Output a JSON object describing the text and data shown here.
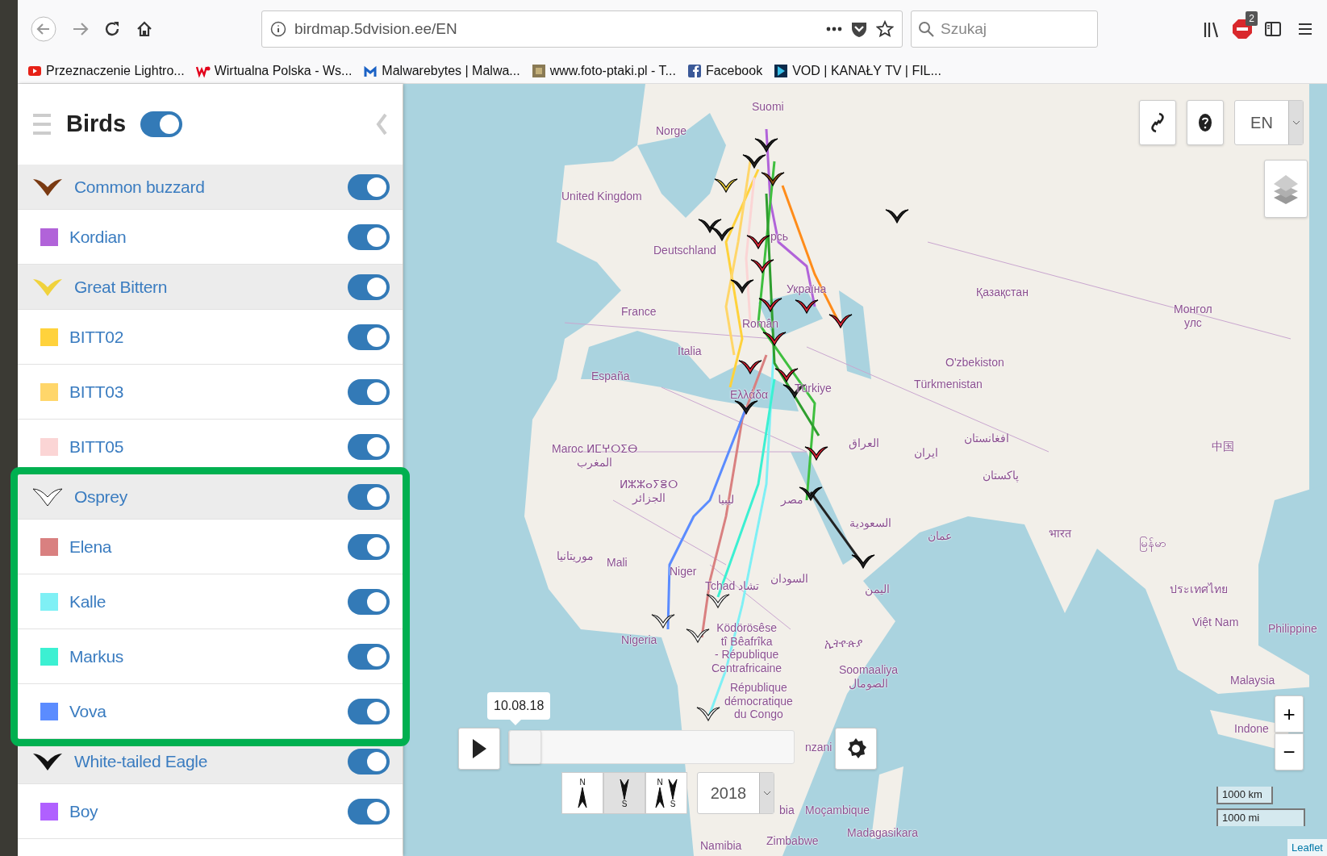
{
  "browser": {
    "url": "birdmap.5dvision.ee/EN",
    "search": {
      "placeholder": "Szukaj"
    },
    "adblock_badge": "2",
    "bookmarks": [
      {
        "kind": "video",
        "label": "Przeznaczenie Lightro..."
      },
      {
        "kind": "portal",
        "label": "Wirtualna Polska - Ws..."
      },
      {
        "kind": "shield",
        "label": "Malwarebytes | Malwa..."
      },
      {
        "kind": "photo",
        "label": "www.foto-ptaki.pl - T..."
      },
      {
        "kind": "social",
        "label": "Facebook"
      },
      {
        "kind": "play",
        "label": "VOD | KANAŁY TV | FIL..."
      }
    ]
  },
  "sidebar": {
    "title": "Birds",
    "on": true,
    "groups": [
      {
        "name": "Common buzzard",
        "color": "#7a3a12",
        "on": true,
        "highlighted": false,
        "birds": [
          {
            "name": "Kordian",
            "color": "#b163d9",
            "on": true
          }
        ]
      },
      {
        "name": "Great Bittern",
        "color": "#f0d23c",
        "on": true,
        "highlighted": false,
        "birds": [
          {
            "name": "BITT02",
            "color": "#ffd23c",
            "on": true
          },
          {
            "name": "BITT03",
            "color": "#ffd66a",
            "on": true
          },
          {
            "name": "BITT05",
            "color": "#fbd5d5",
            "on": true
          }
        ]
      },
      {
        "name": "Osprey",
        "color": "#ffffff",
        "on": true,
        "highlighted": true,
        "birds": [
          {
            "name": "Elena",
            "color": "#d98080",
            "on": true
          },
          {
            "name": "Kalle",
            "color": "#7ff0f5",
            "on": true
          },
          {
            "name": "Markus",
            "color": "#3cf0d2",
            "on": true
          },
          {
            "name": "Vova",
            "color": "#5b8cff",
            "on": true
          }
        ]
      },
      {
        "name": "White-tailed Eagle",
        "color": "#111111",
        "on": true,
        "highlighted": false,
        "birds": [
          {
            "name": "Boy",
            "color": "#b060ff",
            "on": true
          }
        ]
      }
    ]
  },
  "map": {
    "language": "EN",
    "labels": [
      "Suomi",
      "Norge",
      "United Kingdom",
      "Deutschland",
      "рсь",
      "Україна",
      "France",
      "Italia",
      "Român",
      "España",
      "Ελλάδα",
      "Türkiye",
      "Қазақстан",
      "Монгол\nулс",
      "O'zbekiston",
      "Türkmenistan",
      "العراق",
      "ایران",
      "افغانستان",
      "پاکستان",
      "中国",
      "भारत",
      "Maroc ⵍⵎⵖⵔⵉⴱ\nالمغرب",
      "ⵍⵣⵣⴰⵢⴻⵔ\nالجزائر",
      "ليبيا",
      "مصر",
      "السعودية",
      "عمان",
      "اليمن",
      "موريتانيا",
      "Mali",
      "Niger",
      "Tchad تشاد",
      "السودان",
      "Nigeria",
      "Ködörösêse\ntî Bêafrîka\n- République\nCentrafricaine",
      "ኢትዮጵያ",
      "Soomaaliya\nالصومال",
      "République\ndémocratique\ndu Congo",
      "nzani",
      "bia",
      "Moçambique",
      "Madagasikara",
      "Zimbabwe",
      "Namibia",
      "မြန်မာ",
      "ประเทศไทย",
      "Việt Nam",
      "Philippine",
      "Malaysia",
      "Indone"
    ],
    "timeline": {
      "date": "10.08.18",
      "level": 0
    },
    "directions": [
      {
        "labels": [
          "N"
        ],
        "selected": false
      },
      {
        "labels": [
          "S"
        ],
        "selected": true
      },
      {
        "labels": [
          "N",
          "S"
        ],
        "selected": false
      }
    ],
    "year": "2018",
    "zoom_in": "+",
    "zoom_out": "−",
    "scale": [
      "1000 km",
      "1000 mi"
    ],
    "attribution": "Leaflet"
  }
}
